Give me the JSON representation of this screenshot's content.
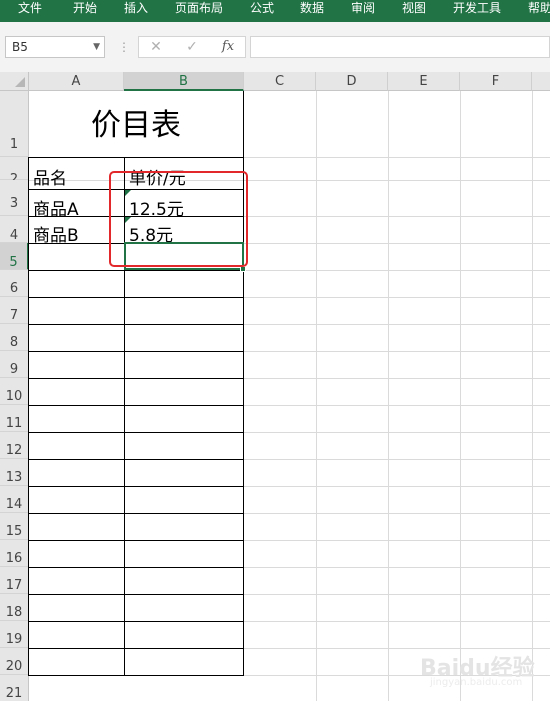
{
  "ribbon": {
    "tabs": [
      "文件",
      "开始",
      "插入",
      "页面布局",
      "公式",
      "数据",
      "审阅",
      "视图",
      "开发工具",
      "帮助"
    ],
    "color": "#217346"
  },
  "formula_bar": {
    "name_box": "B5",
    "cancel_icon": "✕",
    "enter_icon": "✓",
    "fx_label": "fx",
    "formula": ""
  },
  "sheet": {
    "columns": [
      "A",
      "B",
      "C",
      "D",
      "E",
      "F"
    ],
    "rows": [
      "1",
      "2",
      "3",
      "4",
      "5",
      "6",
      "7",
      "8",
      "9",
      "10",
      "11",
      "12",
      "13",
      "14",
      "15",
      "16",
      "17",
      "18",
      "19",
      "20",
      "21"
    ],
    "selected_cell": "B5",
    "title": "价目表",
    "headers": [
      "品名",
      "单价/元"
    ],
    "data": [
      {
        "name": "商品A",
        "price": "12.5元"
      },
      {
        "name": "商品B",
        "price": "5.8元"
      }
    ],
    "highlight_color": "#e2282a"
  },
  "watermark": {
    "main": "Baidu经验",
    "sub": "jingyan.baidu.com"
  }
}
